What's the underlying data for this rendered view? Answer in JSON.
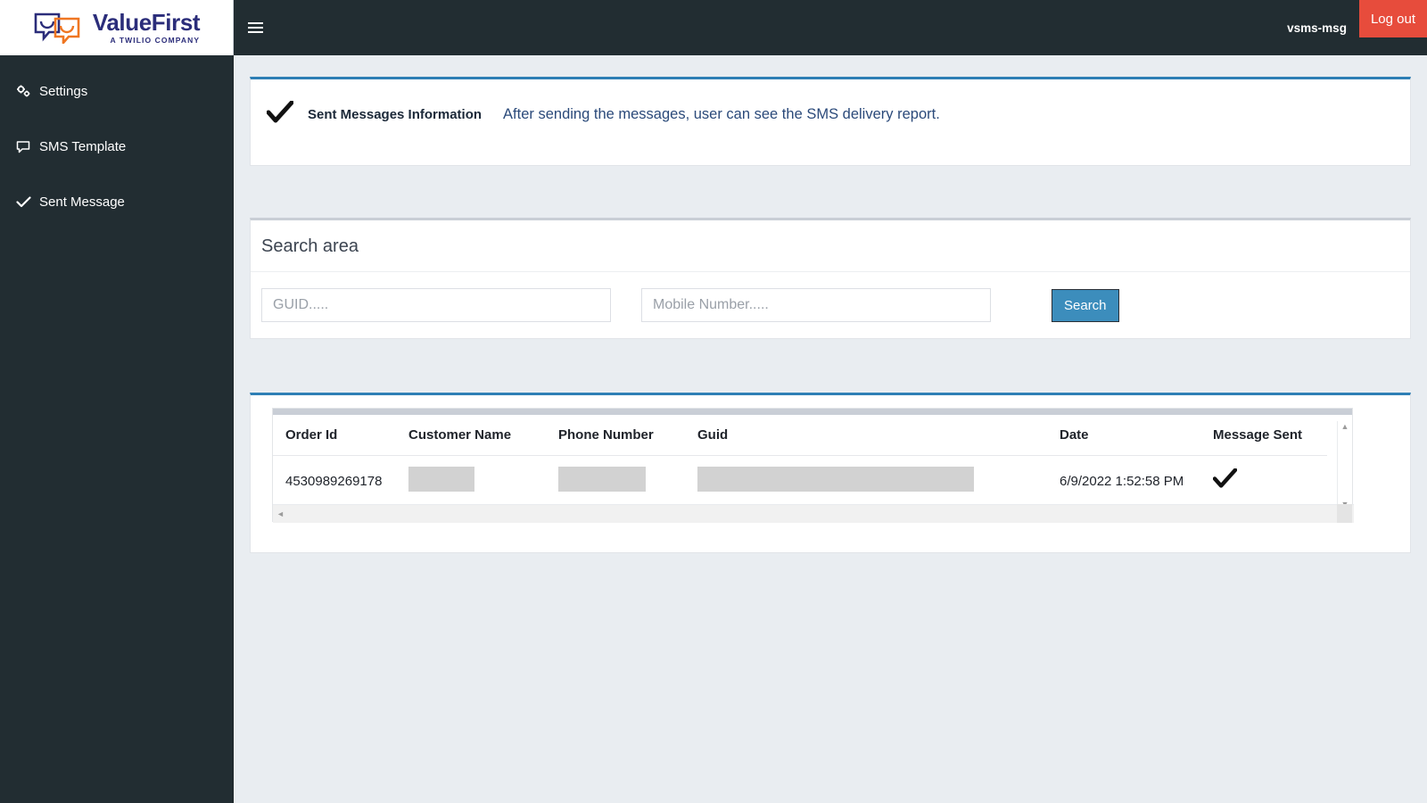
{
  "topbar": {
    "logo": {
      "name": "ValueFirst",
      "subtitle": "A TWILIO COMPANY",
      "icon": "speech-bubbles-logo"
    },
    "menu_toggle_icon": "hamburger-icon",
    "user_name": "vsms-msg",
    "logout_label": "Log out",
    "logout_color": "#e74c3c",
    "bar_color": "#222d32"
  },
  "sidebar": {
    "items": [
      {
        "label": "Settings",
        "icon": "gears-icon"
      },
      {
        "label": "SMS Template",
        "icon": "comment-icon"
      },
      {
        "label": "Sent Message",
        "icon": "check-icon"
      }
    ]
  },
  "info_panel": {
    "icon": "check-icon",
    "title": "Sent Messages Information",
    "description": "After sending the messages, user can see the SMS delivery report.",
    "accent_color": "#2e7fb5"
  },
  "search_panel": {
    "heading": "Search area",
    "guid_field": {
      "value": "",
      "placeholder": "GUID....."
    },
    "mobile_field": {
      "value": "",
      "placeholder": "Mobile Number....."
    },
    "search_button": {
      "label": "Search",
      "color": "#3c8dbc"
    }
  },
  "table_panel": {
    "accent_color": "#2e7fb5",
    "columns": [
      "Order Id",
      "Customer Name",
      "Phone Number",
      "Guid",
      "Date",
      "Message Sent"
    ],
    "rows": [
      {
        "order_id": "4530989269178",
        "customer_name": "",
        "phone_number": "",
        "guid": "",
        "date": "6/9/2022 1:52:58 PM",
        "message_sent_icon": "check-icon"
      }
    ],
    "scroll": {
      "up_arrow": "▲",
      "down_arrow": "▼",
      "left_arrow": "◄",
      "right_arrow": "►"
    }
  }
}
